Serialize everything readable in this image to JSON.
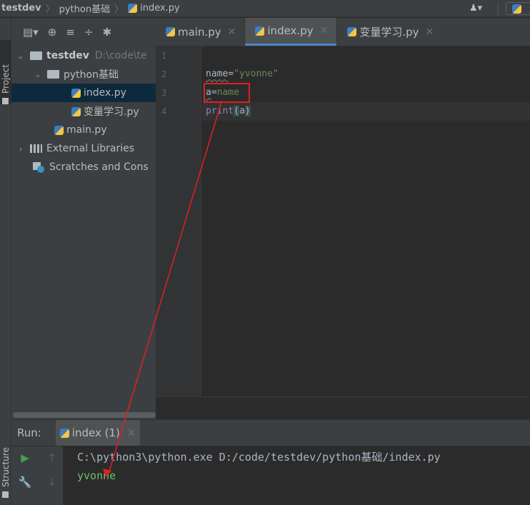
{
  "breadcrumb": {
    "project": "testdev",
    "folder": "python基础",
    "file": "index.py"
  },
  "toolwindows": {
    "project_tab": "Project",
    "structure_tab": "Structure"
  },
  "project_toolbar": {
    "icons": [
      "project-view-icon",
      "dropdown-icon",
      "locate-icon",
      "expand-all-icon",
      "collapse-all-icon",
      "settings-icon"
    ]
  },
  "tree": {
    "root": {
      "label": "testdev",
      "path": "D:\\code\\te"
    },
    "folder": "python基础",
    "files": [
      "index.py",
      "变量学习.py"
    ],
    "main": "main.py",
    "external": "External Libraries",
    "scratches": "Scratches and Cons"
  },
  "editor_tabs": [
    {
      "label": "main.py",
      "active": false
    },
    {
      "label": "index.py",
      "active": true
    },
    {
      "label": "变量学习.py",
      "active": false
    }
  ],
  "gutter": [
    "1",
    "2",
    "3",
    "4"
  ],
  "code": {
    "line2": {
      "var": "name",
      "op": "=",
      "str": "\"yvonne\""
    },
    "line3": {
      "var": "a",
      "op": "=",
      "val": "name"
    },
    "line4": {
      "fn": "print",
      "open": "(",
      "arg": "a",
      "close": ")"
    }
  },
  "run": {
    "label": "Run:",
    "tab": "index (1)",
    "command": "C:\\python3\\python.exe D:/code/testdev/python基础/index.py",
    "output": "yvonne"
  },
  "colors": {
    "annotation_red": "#e02020",
    "selection": "#0d293e",
    "run_green": "#499c54",
    "console_output": "#6cc06c"
  }
}
